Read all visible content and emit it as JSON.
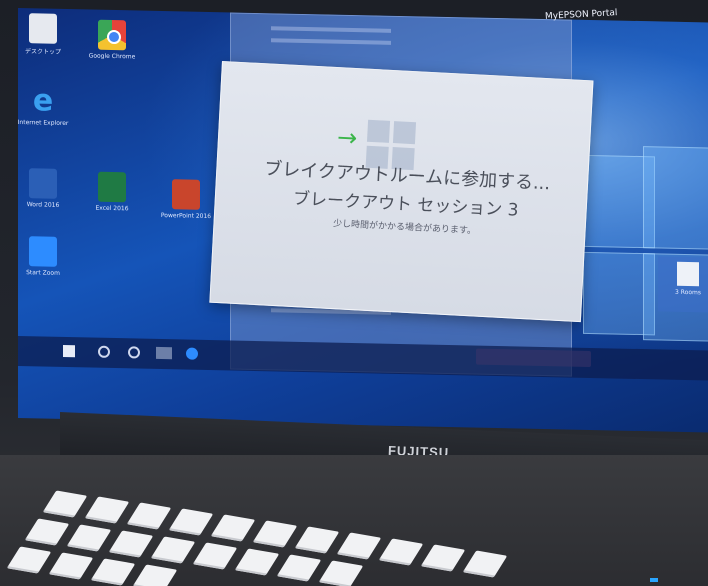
{
  "topbar": {
    "portal_label": "MyEPSON Portal"
  },
  "desktop_icons": [
    {
      "label": "デスクトップ"
    },
    {
      "label": "Google Chrome"
    },
    {
      "label": "Internet Explorer"
    },
    {
      "label": "Word 2016"
    },
    {
      "label": "Excel 2016"
    },
    {
      "label": "PowerPoint 2016"
    },
    {
      "label": "Start Zoom"
    }
  ],
  "dialog": {
    "title": "ブレイクアウトルームに参加する...",
    "session": "ブレークアウト セッション 3",
    "note": "少し時間がかかる場合があります。"
  },
  "tile": {
    "label": "3 Rooms"
  },
  "brand": {
    "name": "FUJITSU"
  },
  "colors": {
    "accent_arrow": "#3bb54a",
    "desktop_blue": "#1554b8"
  }
}
